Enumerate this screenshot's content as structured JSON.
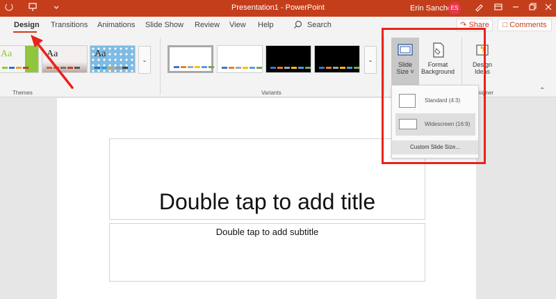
{
  "titlebar": {
    "title": "Presentation1  -  PowerPoint",
    "user_name": "Erin Sanchez",
    "user_initials": "ES",
    "icons": [
      "undo-icon",
      "present-icon",
      "customize-icon",
      "pen-icon",
      "ribbon-display-icon",
      "minimize-icon",
      "restore-icon",
      "close-icon"
    ]
  },
  "tabs": {
    "items": [
      "Design",
      "Transitions",
      "Animations",
      "Slide Show",
      "Review",
      "View",
      "Help"
    ],
    "active": "Design",
    "search_label": "Search",
    "share_label": "Share",
    "comments_label": "Comments"
  },
  "ribbon": {
    "themes_label": "Themes",
    "variants_label": "Variants",
    "designer_label": "Designer",
    "slide_size_line1": "Slide",
    "slide_size_line2": "Size",
    "format_bg_line1": "Format",
    "format_bg_line2": "Background",
    "design_ideas_line1": "Design",
    "design_ideas_line2": "Ideas",
    "theme_thumbs": [
      "Aa",
      "Aa",
      "Aa"
    ]
  },
  "dropdown": {
    "standard": "Standard (4:3)",
    "widescreen": "Widescreen (16:9)",
    "custom": "Custom Slide Size..."
  },
  "slide": {
    "title_placeholder": "Double tap to add title",
    "subtitle_placeholder": "Double tap to add subtitle"
  },
  "colors": {
    "accent": "#c43e1c",
    "highlight": "#e8231b"
  }
}
